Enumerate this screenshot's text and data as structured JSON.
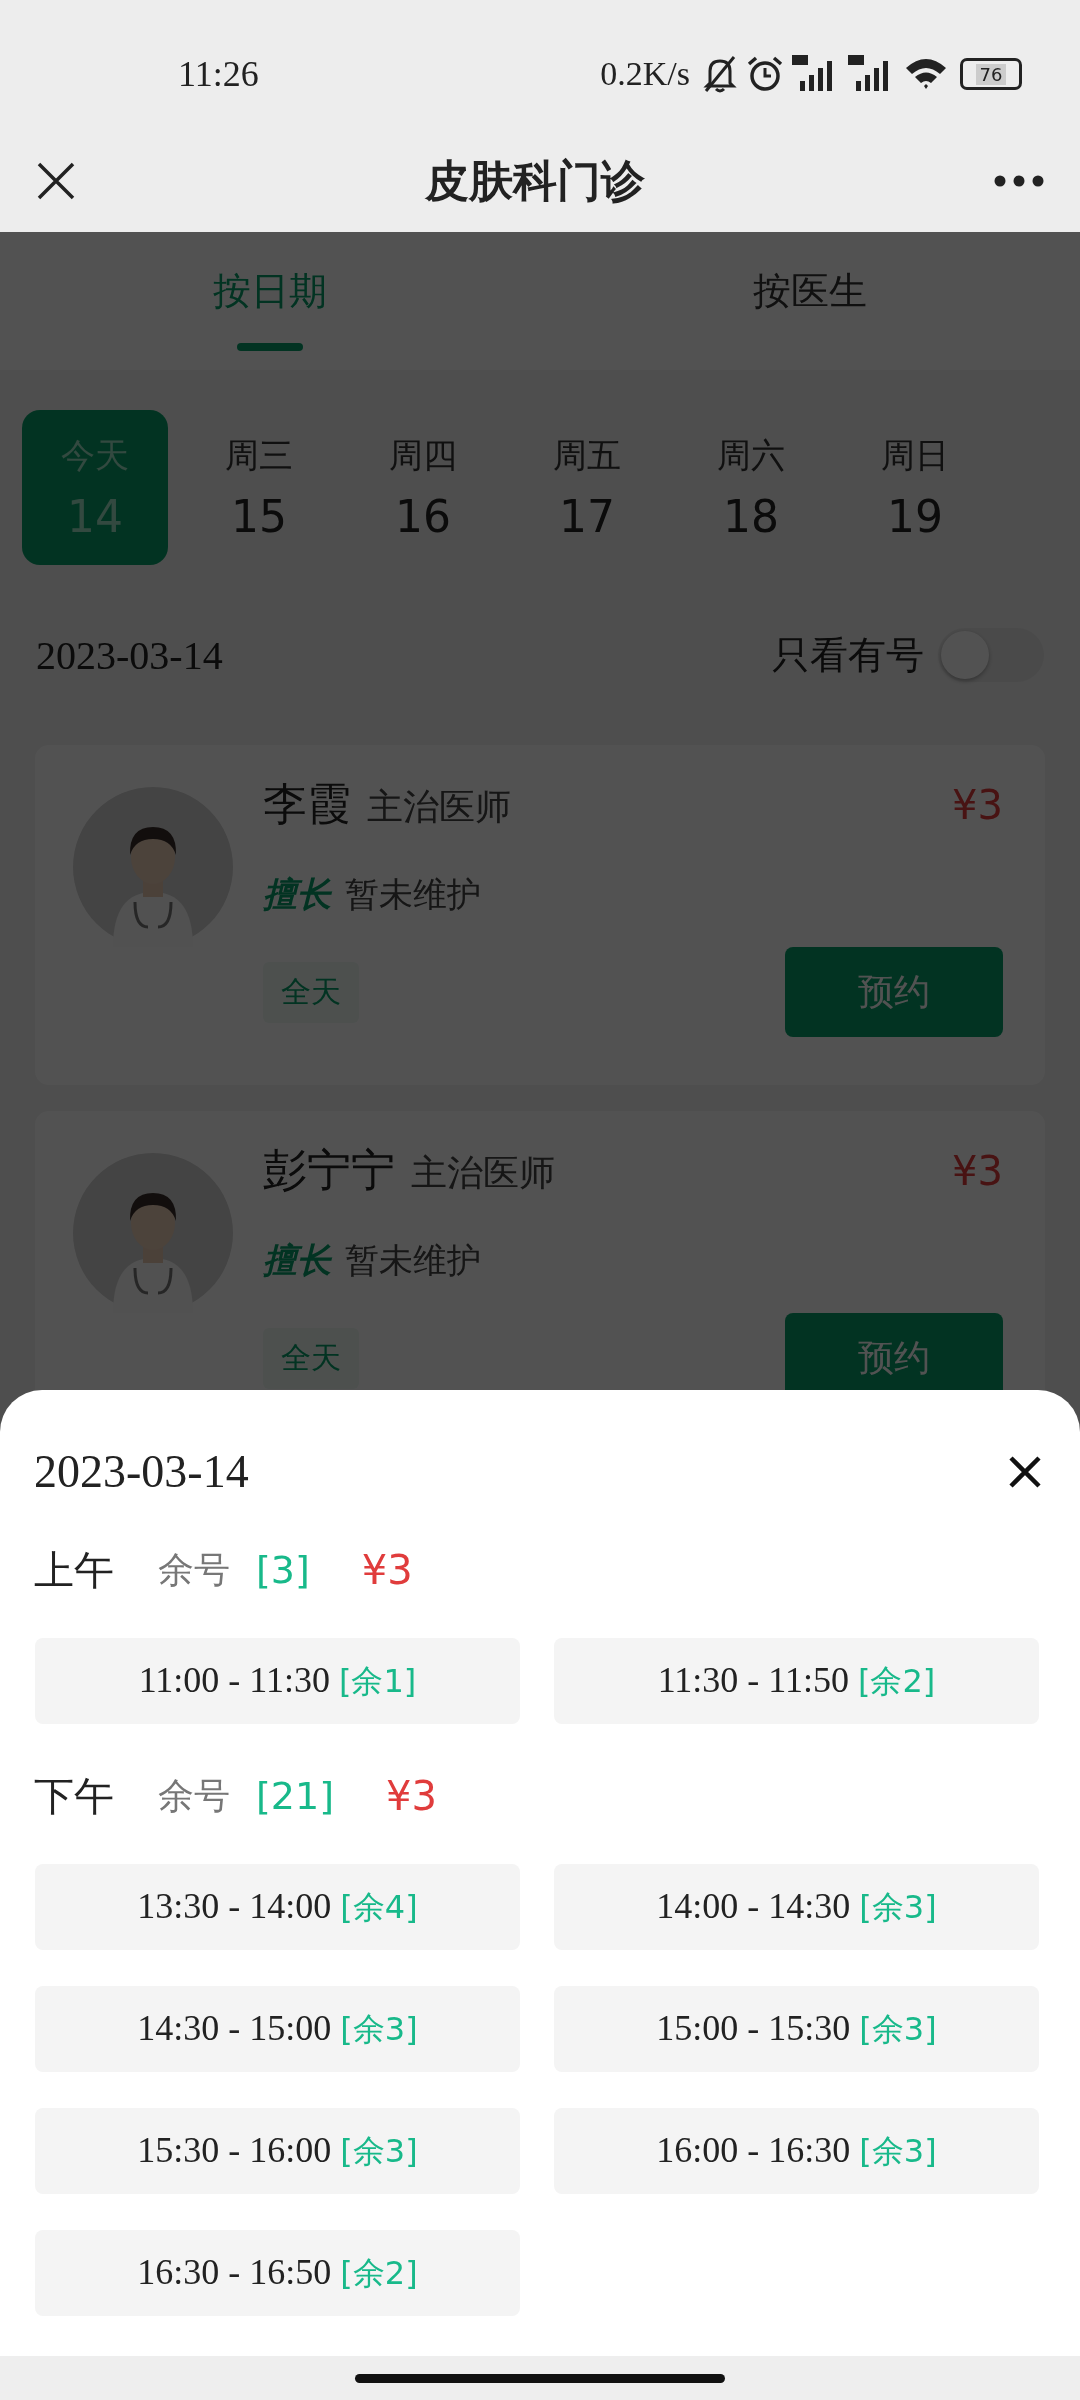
{
  "status_bar": {
    "time": "11:26",
    "net_speed": "0.2K/s",
    "battery": "76"
  },
  "nav": {
    "title": "皮肤科门诊"
  },
  "tabs": [
    {
      "label": "按日期",
      "selected": true
    },
    {
      "label": "按医生",
      "selected": false
    }
  ],
  "days": [
    {
      "weekday": "今天",
      "day": "14",
      "selected": true
    },
    {
      "weekday": "周三",
      "day": "15",
      "selected": false
    },
    {
      "weekday": "周四",
      "day": "16",
      "selected": false
    },
    {
      "weekday": "周五",
      "day": "17",
      "selected": false
    },
    {
      "weekday": "周六",
      "day": "18",
      "selected": false
    },
    {
      "weekday": "周日",
      "day": "19",
      "selected": false
    }
  ],
  "date": "2023-03-14",
  "filter": {
    "label": "只看有号",
    "on": false
  },
  "doctors": [
    {
      "name": "李霞",
      "title": "主治医师",
      "price": "¥3",
      "specialty_tag": "擅长",
      "specialty": "暂未维护",
      "session": "全天",
      "action": "预约"
    },
    {
      "name": "彭宁宁",
      "title": "主治医师",
      "price": "¥3",
      "specialty_tag": "擅长",
      "specialty": "暂未维护",
      "session": "全天",
      "action": "预约"
    }
  ],
  "sheet": {
    "date": "2023-03-14",
    "periods": [
      {
        "label": "上午",
        "remain_label": "余号",
        "remain": "[3]",
        "price": "¥3",
        "slots": [
          {
            "time": "11:00 - 11:30",
            "remain": "[余1]"
          },
          {
            "time": "11:30 - 11:50",
            "remain": "[余2]"
          }
        ]
      },
      {
        "label": "下午",
        "remain_label": "余号",
        "remain": "[21]",
        "price": "¥3",
        "slots": [
          {
            "time": "13:30 - 14:00",
            "remain": "[余4]"
          },
          {
            "time": "14:00 - 14:30",
            "remain": "[余3]"
          },
          {
            "time": "14:30 - 15:00",
            "remain": "[余3]"
          },
          {
            "time": "15:00 - 15:30",
            "remain": "[余3]"
          },
          {
            "time": "15:30 - 16:00",
            "remain": "[余3]"
          },
          {
            "time": "16:00 - 16:30",
            "remain": "[余3]"
          },
          {
            "time": "16:30 - 16:50",
            "remain": "[余2]"
          }
        ]
      }
    ]
  }
}
